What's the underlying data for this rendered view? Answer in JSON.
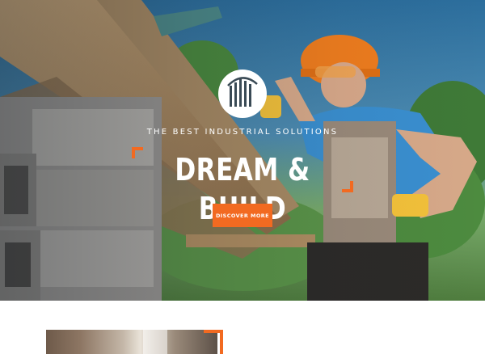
{
  "hero": {
    "tagline": "THE BEST INDUSTRIAL SOLUTIONS",
    "headline": "DREAM & BUILD",
    "cta_label": "DISCOVER MORE"
  },
  "colors": {
    "accent": "#f26a21",
    "text_on_hero": "#ffffff",
    "page_background": "#ffffff"
  },
  "icons": {
    "logo": "building-columns-logo"
  }
}
